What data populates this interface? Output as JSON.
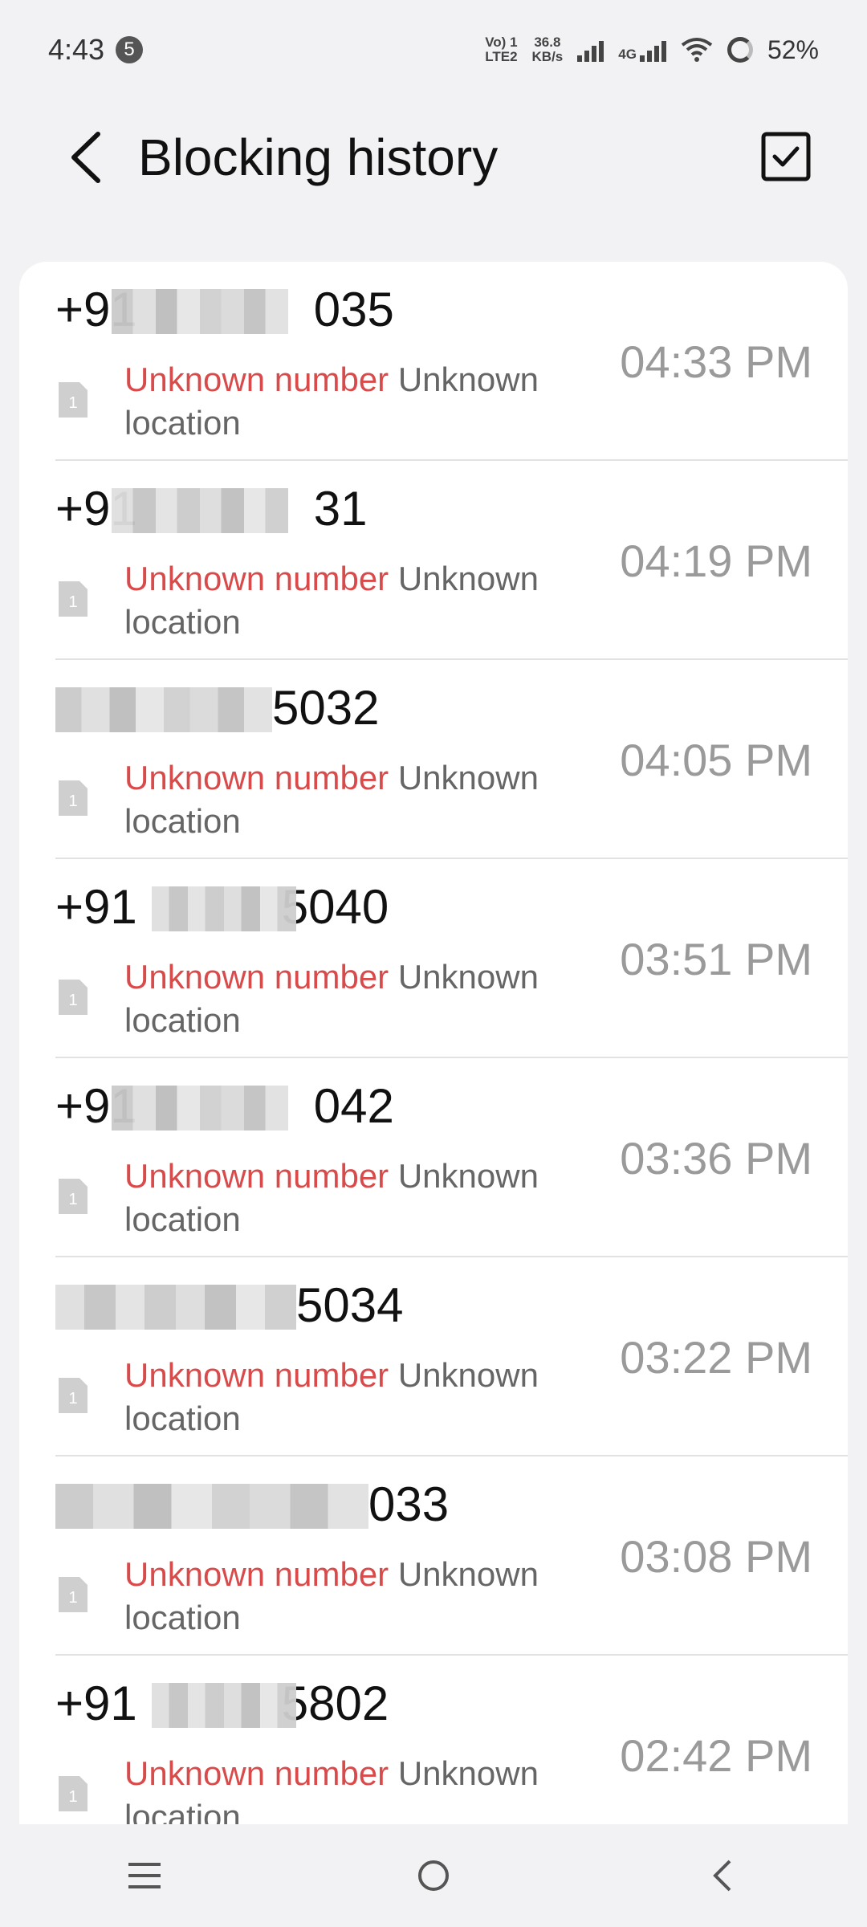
{
  "status_bar": {
    "time": "4:43",
    "notification_count": "5",
    "volte": "Vo) 1",
    "lte": "LTE2",
    "speed_value": "36.8",
    "speed_unit": "KB/s",
    "network": "4G",
    "battery": "52%"
  },
  "header": {
    "title": "Blocking history",
    "back_icon": "back-arrow-icon",
    "select_icon": "checkbox-checked-icon"
  },
  "list": {
    "items": [
      {
        "number_prefix": "+91",
        "number_suffix": "035",
        "tag": "Unknown number",
        "location": "Unknown location",
        "time": "04:33 PM"
      },
      {
        "number_prefix": "+91",
        "number_suffix": "31",
        "tag": "Unknown number",
        "location": "Unknown location",
        "time": "04:19 PM"
      },
      {
        "number_prefix": "",
        "number_suffix": "5032",
        "tag": "Unknown number",
        "location": "Unknown location",
        "time": "04:05 PM"
      },
      {
        "number_prefix": "+91",
        "number_suffix": "5040",
        "tag": "Unknown number",
        "location": "Unknown location",
        "time": "03:51 PM"
      },
      {
        "number_prefix": "+91",
        "number_suffix": "042",
        "tag": "Unknown number",
        "location": "Unknown location",
        "time": "03:36 PM"
      },
      {
        "number_prefix": "",
        "number_suffix": "5034",
        "tag": "Unknown number",
        "location": "Unknown location",
        "time": "03:22 PM"
      },
      {
        "number_prefix": "",
        "number_suffix": "033",
        "tag": "Unknown number",
        "location": "Unknown location",
        "time": "03:08 PM"
      },
      {
        "number_prefix": "+91",
        "number_suffix": "5802",
        "tag": "Unknown number",
        "location": "Unknown location",
        "time": "02:42 PM"
      }
    ],
    "sim_label": "1"
  },
  "nav_bar": {
    "menu_icon": "menu-icon",
    "home_icon": "home-circle-icon",
    "back_icon": "back-chevron-icon"
  },
  "colors": {
    "tag_red": "#d94b4b",
    "time_gray": "#9a9a9a",
    "background": "#f2f2f4"
  }
}
